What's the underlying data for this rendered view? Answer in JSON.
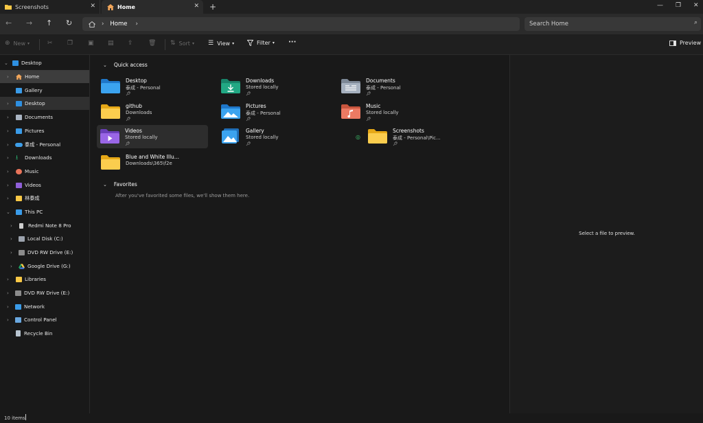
{
  "tabs": [
    {
      "label": "Screenshots",
      "icon": "folder-icon",
      "active": false
    },
    {
      "label": "Home",
      "icon": "home-icon",
      "active": true
    }
  ],
  "window_controls": [
    "minimize-icon",
    "maximize-icon",
    "close-icon"
  ],
  "address": {
    "segments": [
      "Home"
    ]
  },
  "search": {
    "placeholder": "Search Home"
  },
  "toolbar": {
    "new_label": "New",
    "sort_label": "Sort",
    "view_label": "View",
    "filter_label": "Filter",
    "more_label": "···",
    "preview_label": "Preview"
  },
  "sidebar": {
    "items": [
      {
        "label": "Desktop",
        "icon": "desktop-icon",
        "level": 0,
        "expanded": true
      },
      {
        "label": "Home",
        "icon": "home-icon",
        "level": 1,
        "selected": true
      },
      {
        "label": "Gallery",
        "icon": "gallery-icon",
        "level": 1
      },
      {
        "label": "Desktop",
        "icon": "desktop-icon",
        "level": 1,
        "hover": true
      },
      {
        "label": "Documents",
        "icon": "documents-icon",
        "level": 1
      },
      {
        "label": "Pictures",
        "icon": "pictures-icon",
        "level": 1
      },
      {
        "label": "泰成 - Personal",
        "icon": "onedrive-icon",
        "level": 1
      },
      {
        "label": "Downloads",
        "icon": "downloads-icon",
        "level": 1
      },
      {
        "label": "Music",
        "icon": "music-icon",
        "level": 1
      },
      {
        "label": "Videos",
        "icon": "videos-icon",
        "level": 1
      },
      {
        "label": "林泰成",
        "icon": "folder-icon",
        "level": 1
      },
      {
        "label": "This PC",
        "icon": "computer-icon",
        "level": 1,
        "expanded": true
      },
      {
        "label": "Redmi Note 8 Pro",
        "icon": "phone-icon",
        "level": 2
      },
      {
        "label": "Local Disk (C:)",
        "icon": "disk-icon",
        "level": 2
      },
      {
        "label": "DVD RW Drive (E:)",
        "icon": "dvd-icon",
        "level": 2
      },
      {
        "label": "Google Drive (G:)",
        "icon": "google-drive-icon",
        "level": 2
      },
      {
        "label": "Libraries",
        "icon": "libraries-icon",
        "level": 1
      },
      {
        "label": "DVD RW Drive (E:)",
        "icon": "dvd-icon",
        "level": 1
      },
      {
        "label": "Network",
        "icon": "network-icon",
        "level": 1
      },
      {
        "label": "Control Panel",
        "icon": "control-panel-icon",
        "level": 1
      },
      {
        "label": "Recycle Bin",
        "icon": "recycle-bin-icon",
        "level": 1
      }
    ]
  },
  "quick_access": {
    "title": "Quick access",
    "items": [
      {
        "name": "Desktop",
        "sub": "泰成 - Personal",
        "icon": "desktop-folder-icon",
        "pinned": true
      },
      {
        "name": "Downloads",
        "sub": "Stored locally",
        "icon": "downloads-folder-icon",
        "pinned": true
      },
      {
        "name": "Documents",
        "sub": "泰成 - Personal",
        "icon": "documents-folder-icon",
        "pinned": true
      },
      {
        "name": "github",
        "sub": "Downloads",
        "icon": "folder-icon",
        "pinned": true
      },
      {
        "name": "Pictures",
        "sub": "泰成 - Personal",
        "icon": "pictures-folder-icon",
        "pinned": true
      },
      {
        "name": "Music",
        "sub": "Stored locally",
        "icon": "music-folder-icon",
        "pinned": true
      },
      {
        "name": "Videos",
        "sub": "Stored locally",
        "icon": "videos-folder-icon",
        "pinned": true,
        "highlighted": true
      },
      {
        "name": "Gallery",
        "sub": "Stored locally",
        "icon": "gallery-icon",
        "pinned": true
      },
      {
        "name": "Screenshots",
        "sub": "泰成 - Personal\\Pic...",
        "icon": "folder-icon",
        "pinned": true,
        "synced": true
      },
      {
        "name": "Blue and White Illu...",
        "sub": "Downloads\\365\\f2e",
        "icon": "folder-icon",
        "pinned": false
      }
    ]
  },
  "favorites": {
    "title": "Favorites",
    "empty_text": "After you've favorited some files, we'll show them here."
  },
  "preview": {
    "message": "Select a file to preview."
  },
  "status": {
    "items_count": "10 items"
  },
  "colors": {
    "folder": "#f9c846",
    "accent": "#2a8ddc",
    "selected": "#3d3d3d",
    "background": "#191919"
  }
}
